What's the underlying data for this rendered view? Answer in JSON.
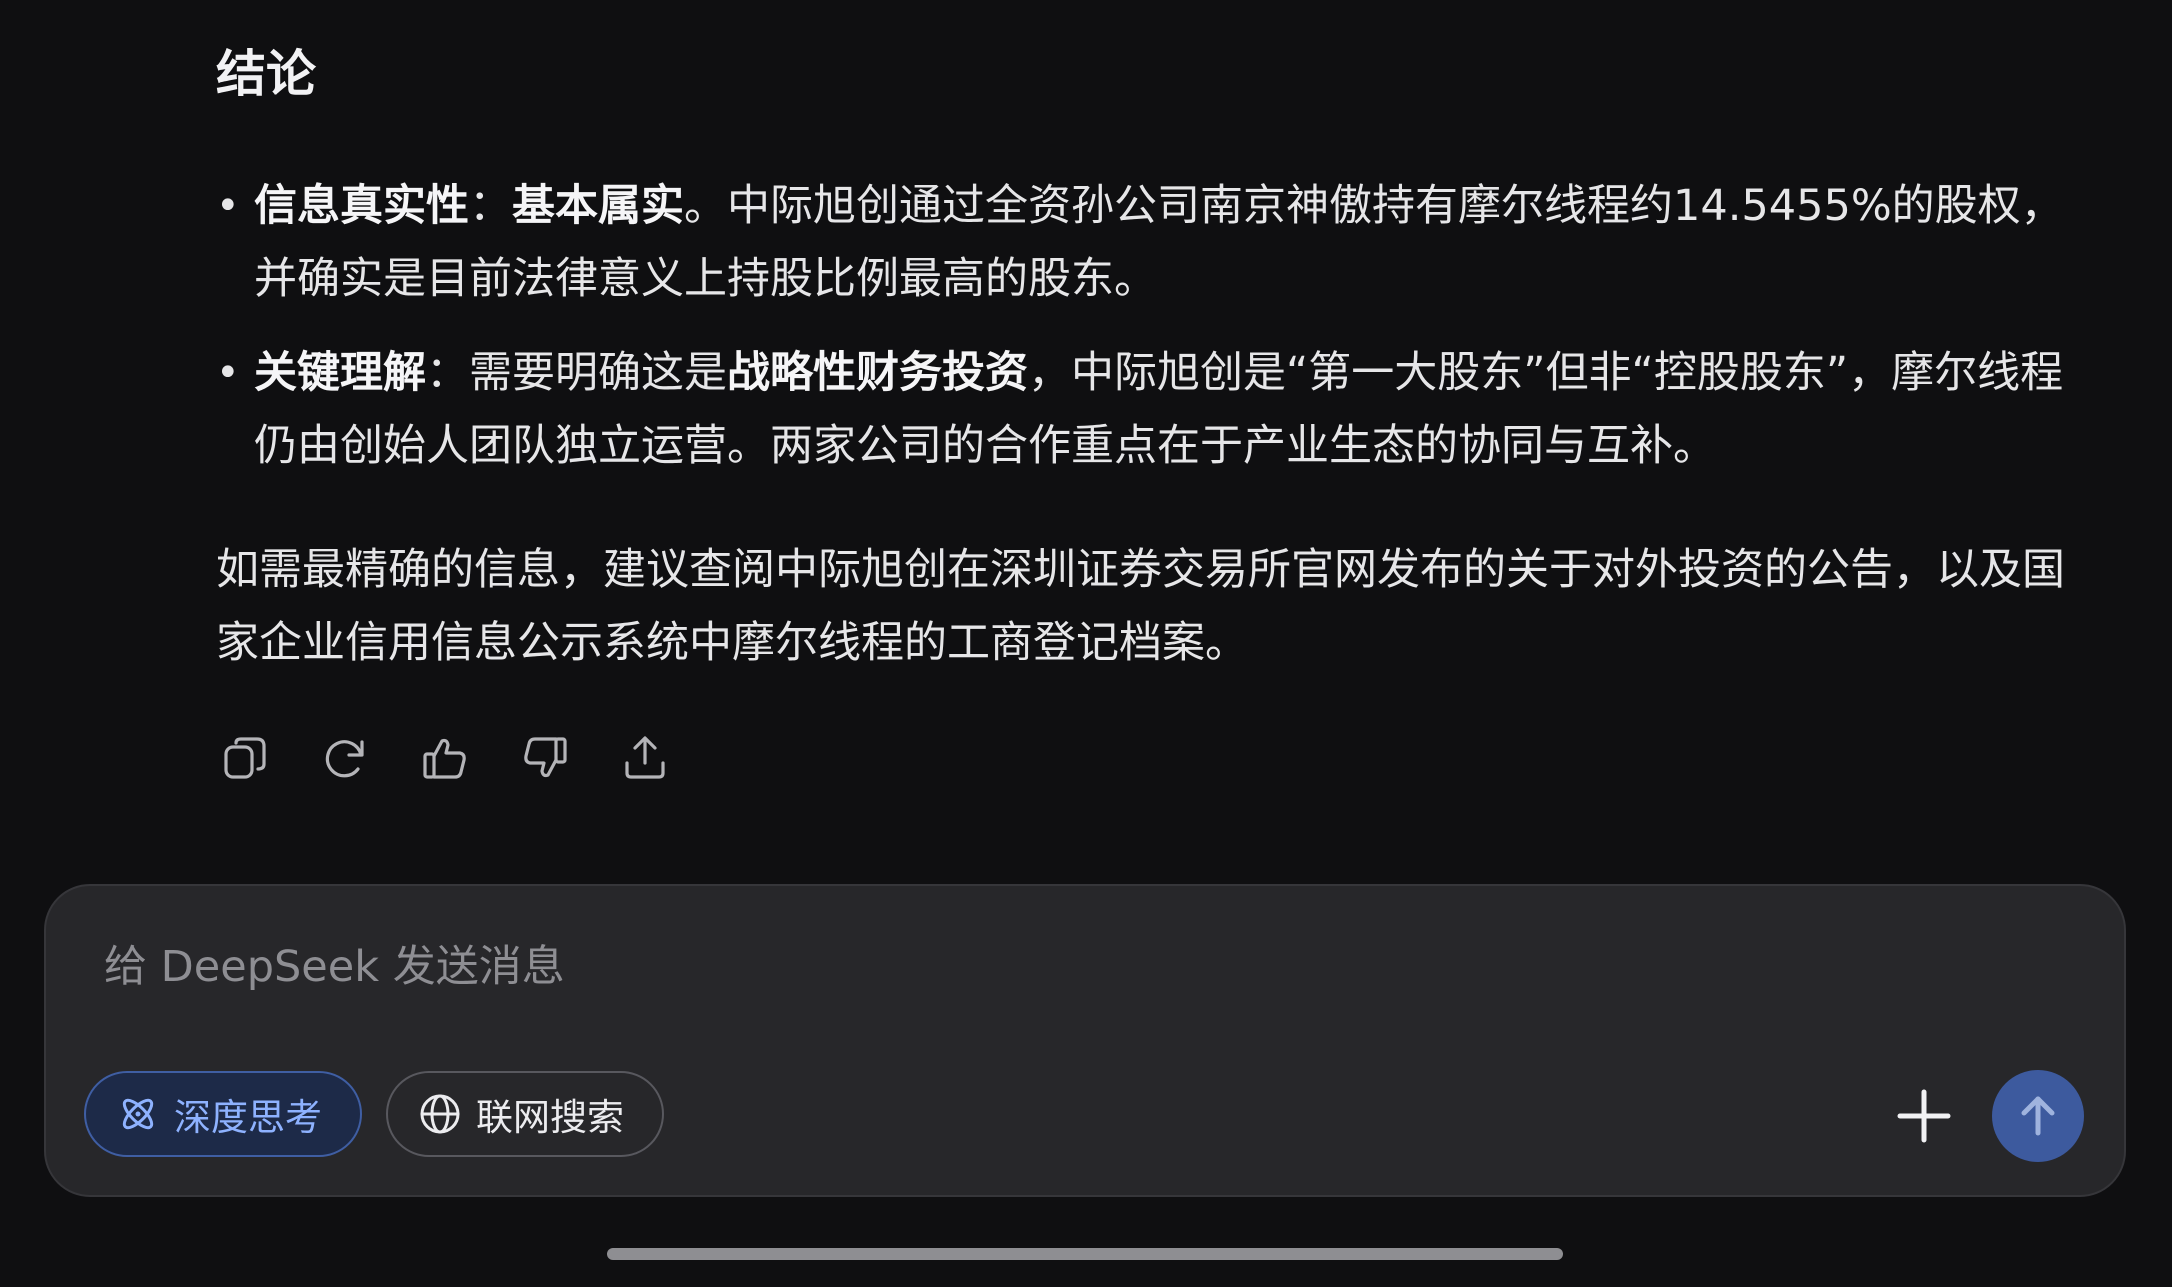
{
  "message": {
    "heading": "结论",
    "bullets": [
      {
        "label": "信息真实性",
        "sep": "：",
        "emphasis": "基本属实",
        "text": "。中际旭创通过全资孙公司南京神傲持有摩尔线程约14.5455%的股权，并确实是目前法律意义上持股比例最高的股东。"
      },
      {
        "label": "关键理解",
        "sep": "：",
        "text_before": "需要明确这是",
        "emphasis": "战略性财务投资",
        "text_after": "，中际旭创是“第一大股东”但非“控股股东”，摩尔线程仍由创始人团队独立运营。两家公司的合作重点在于产业生态的协同与互补。"
      }
    ],
    "paragraph": "如需最精确的信息，建议查阅中际旭创在深圳证券交易所官网发布的关于对外投资的公告，以及国家企业信用信息公示系统中摩尔线程的工商登记档案。"
  },
  "actions": [
    {
      "icon": "copy-icon"
    },
    {
      "icon": "regenerate-icon"
    },
    {
      "icon": "thumbs-up-icon"
    },
    {
      "icon": "thumbs-down-icon"
    },
    {
      "icon": "share-icon"
    }
  ],
  "composer": {
    "placeholder": "给 DeepSeek 发送消息",
    "deep_think_label": "深度思考",
    "web_search_label": "联网搜索",
    "deep_think_active": true,
    "web_search_active": false
  },
  "colors": {
    "background": "#0f0f11",
    "composer_bg": "#27272a",
    "accent": "#8eb2ff",
    "send_button": "#3d5a9e"
  }
}
